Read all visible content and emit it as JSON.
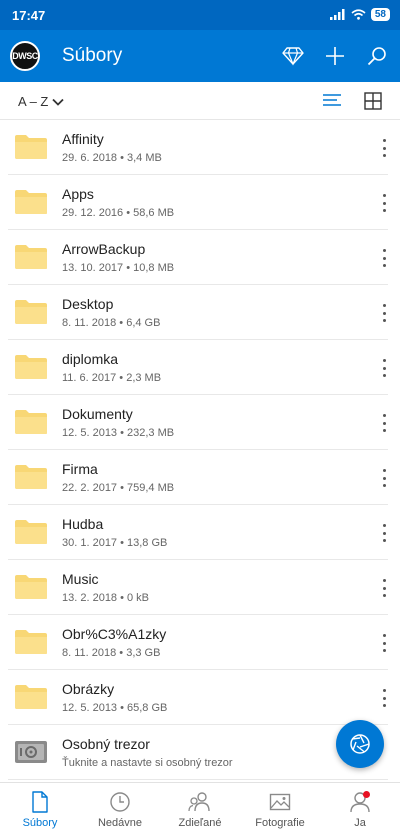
{
  "status_bar": {
    "time": "17:47",
    "battery": "58"
  },
  "app_bar": {
    "avatar_text": "DWSC",
    "title": "Súbory"
  },
  "sort": {
    "label": "A – Z"
  },
  "items": [
    {
      "name": "Affinity",
      "meta": "29. 6. 2018 • 3,4 MB",
      "type": "folder"
    },
    {
      "name": "Apps",
      "meta": "29. 12. 2016 • 58,6 MB",
      "type": "folder"
    },
    {
      "name": "ArrowBackup",
      "meta": "13. 10. 2017 • 10,8 MB",
      "type": "folder"
    },
    {
      "name": "Desktop",
      "meta": "8. 11. 2018 • 6,4 GB",
      "type": "folder"
    },
    {
      "name": "diplomka",
      "meta": "11. 6. 2017 • 2,3 MB",
      "type": "folder"
    },
    {
      "name": "Dokumenty",
      "meta": "12. 5. 2013 • 232,3 MB",
      "type": "folder"
    },
    {
      "name": "Firma",
      "meta": "22. 2. 2017 • 759,4 MB",
      "type": "folder"
    },
    {
      "name": "Hudba",
      "meta": "30. 1. 2017 • 13,8 GB",
      "type": "folder"
    },
    {
      "name": "Music",
      "meta": "13. 2. 2018 • 0 kB",
      "type": "folder"
    },
    {
      "name": "Obr%C3%A1zky",
      "meta": "8. 11. 2018 • 3,3 GB",
      "type": "folder"
    },
    {
      "name": "Obrázky",
      "meta": "12. 5. 2013 • 65,8 GB",
      "type": "folder"
    },
    {
      "name": "Osobný trezor",
      "meta": "Ťuknite a nastavte si osobný trezor",
      "type": "vault"
    }
  ],
  "bottom_nav": [
    {
      "label": "Súbory",
      "icon": "file-icon",
      "active": true
    },
    {
      "label": "Nedávne",
      "icon": "clock-icon"
    },
    {
      "label": "Zdieľané",
      "icon": "people-icon"
    },
    {
      "label": "Fotografie",
      "icon": "photo-icon"
    },
    {
      "label": "Ja",
      "icon": "person-icon"
    }
  ],
  "colors": {
    "primary": "#0078d4",
    "status_bar": "#0067c0",
    "folder": "#f8d775",
    "badge": "#e81123"
  }
}
